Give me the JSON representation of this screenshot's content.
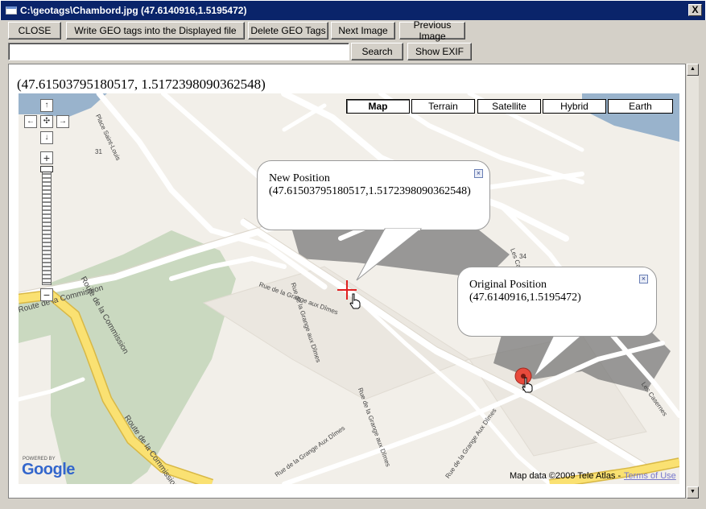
{
  "window": {
    "title": "C:\\geotags\\Chambord.jpg (47.6140916,1.5195472)",
    "close_glyph": "X"
  },
  "toolbar": {
    "close_label": "CLOSE",
    "write_label": "Write GEO tags into the Displayed file",
    "delete_label": "Delete GEO Tags",
    "next_label": "Next Image",
    "previous_label": "Previous Image",
    "search_label": "Search",
    "show_exif_label": "Show EXIF"
  },
  "search": {
    "value": "",
    "placeholder": ""
  },
  "content": {
    "coords_heading": "(47.61503795180517, 1.5172398090362548)"
  },
  "map": {
    "types": [
      "Map",
      "Terrain",
      "Satellite",
      "Hybrid",
      "Earth"
    ],
    "active_type": "Map",
    "new_position": {
      "title": "New Position",
      "coords": "(47.61503795180517,1.5172398090362548)"
    },
    "original_position": {
      "title": "Original Position",
      "coords": "(47.6140916,1.5195472)"
    },
    "streets": {
      "route_commission_1": "Route de la Commission",
      "route_commission_2": "Route de la Commission",
      "route_commission_3": "Route de la Commission",
      "grange_1": "Rue de la Grange aux Dîmes",
      "grange_2": "Rue de la Grange aux Dîmes",
      "grange_3": "Rue de la Grange aux Dîmes",
      "grange_4": "Rue de la Grange Aux Dîmes",
      "place_saint_louis": "Place Saint-Louis",
      "casernes": "Les Casernes",
      "les_ca": "Les Ca",
      "num_31": "31",
      "num_34": "34"
    },
    "powered_by": "POWERED BY",
    "google": "Google",
    "map_data": "Map data ©2009 Tele Atlas -",
    "terms": "Terms of Use",
    "colors": {
      "land": "#f2efe9",
      "park": "#cad9c0",
      "water": "#99b3cc",
      "route": "#fae172",
      "road": "#ffffff",
      "marker": "#e84a3c"
    }
  },
  "scrollbar": {
    "up_icon": "▲",
    "down_icon": "▼"
  }
}
